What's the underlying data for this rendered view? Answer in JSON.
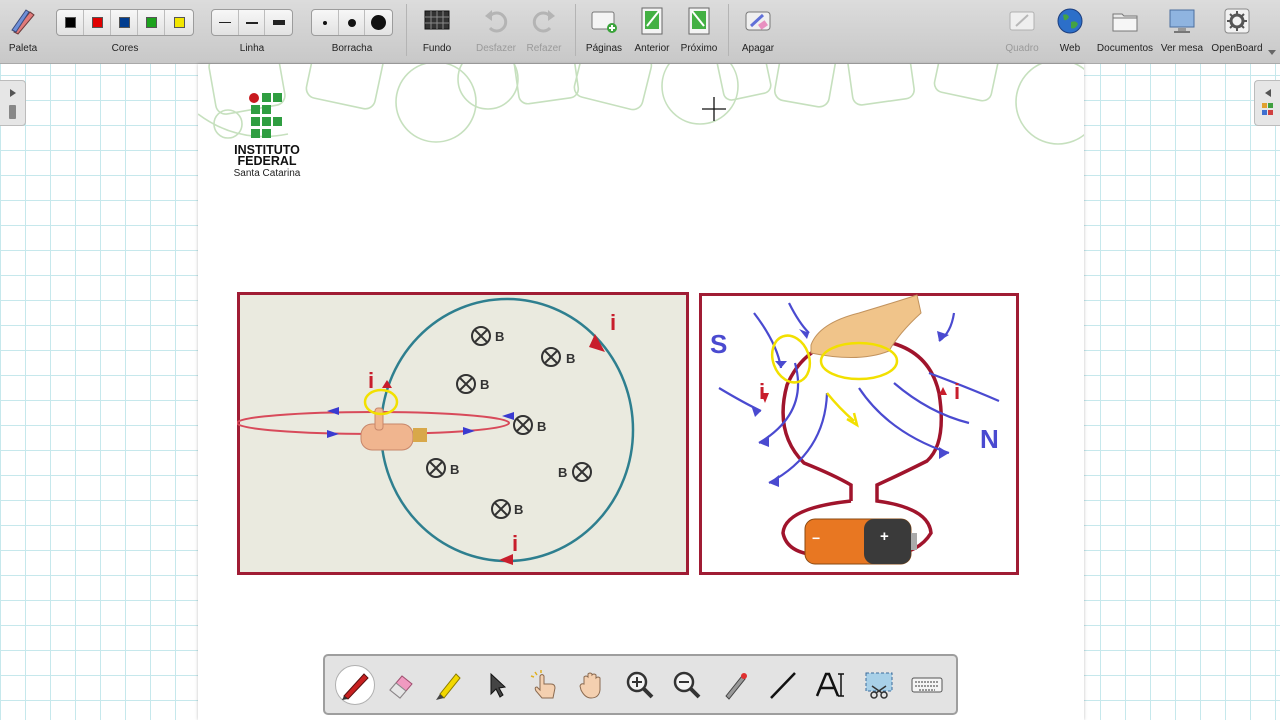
{
  "toolbar": {
    "palette": "Paleta",
    "colors": "Cores",
    "line": "Linha",
    "eraser": "Borracha",
    "background": "Fundo",
    "undo": "Desfazer",
    "redo": "Refazer",
    "pages": "Páginas",
    "previous": "Anterior",
    "next": "Próximo",
    "clear": "Apagar",
    "board": "Quadro",
    "web": "Web",
    "documents": "Documentos",
    "desktop": "Ver mesa",
    "openboard": "OpenBoard"
  },
  "color_swatches": [
    "#000000",
    "#e00000",
    "#003c8f",
    "#1ca21c",
    "#f2e600"
  ],
  "logo": {
    "line1": "INSTITUTO",
    "line2": "FEDERAL",
    "line3": "Santa Catarina"
  },
  "slide": {
    "current_label": "i",
    "field_label": "B",
    "pole_south": "S",
    "pole_north": "N",
    "battery_minus": "−",
    "battery_plus": "+"
  },
  "colors": {
    "wire": "#c11b2f",
    "field": "#4a4ad0",
    "annotation": "#f2e000",
    "loop": "#2e7f8f"
  },
  "bottom_tools": [
    "pen-tool",
    "eraser-tool",
    "highlighter-tool",
    "selector-tool",
    "interact-tool",
    "hand-tool",
    "zoom-in-tool",
    "zoom-out-tool",
    "laser-pointer-tool",
    "line-tool",
    "text-tool",
    "capture-tool",
    "virtual-keyboard-tool"
  ]
}
